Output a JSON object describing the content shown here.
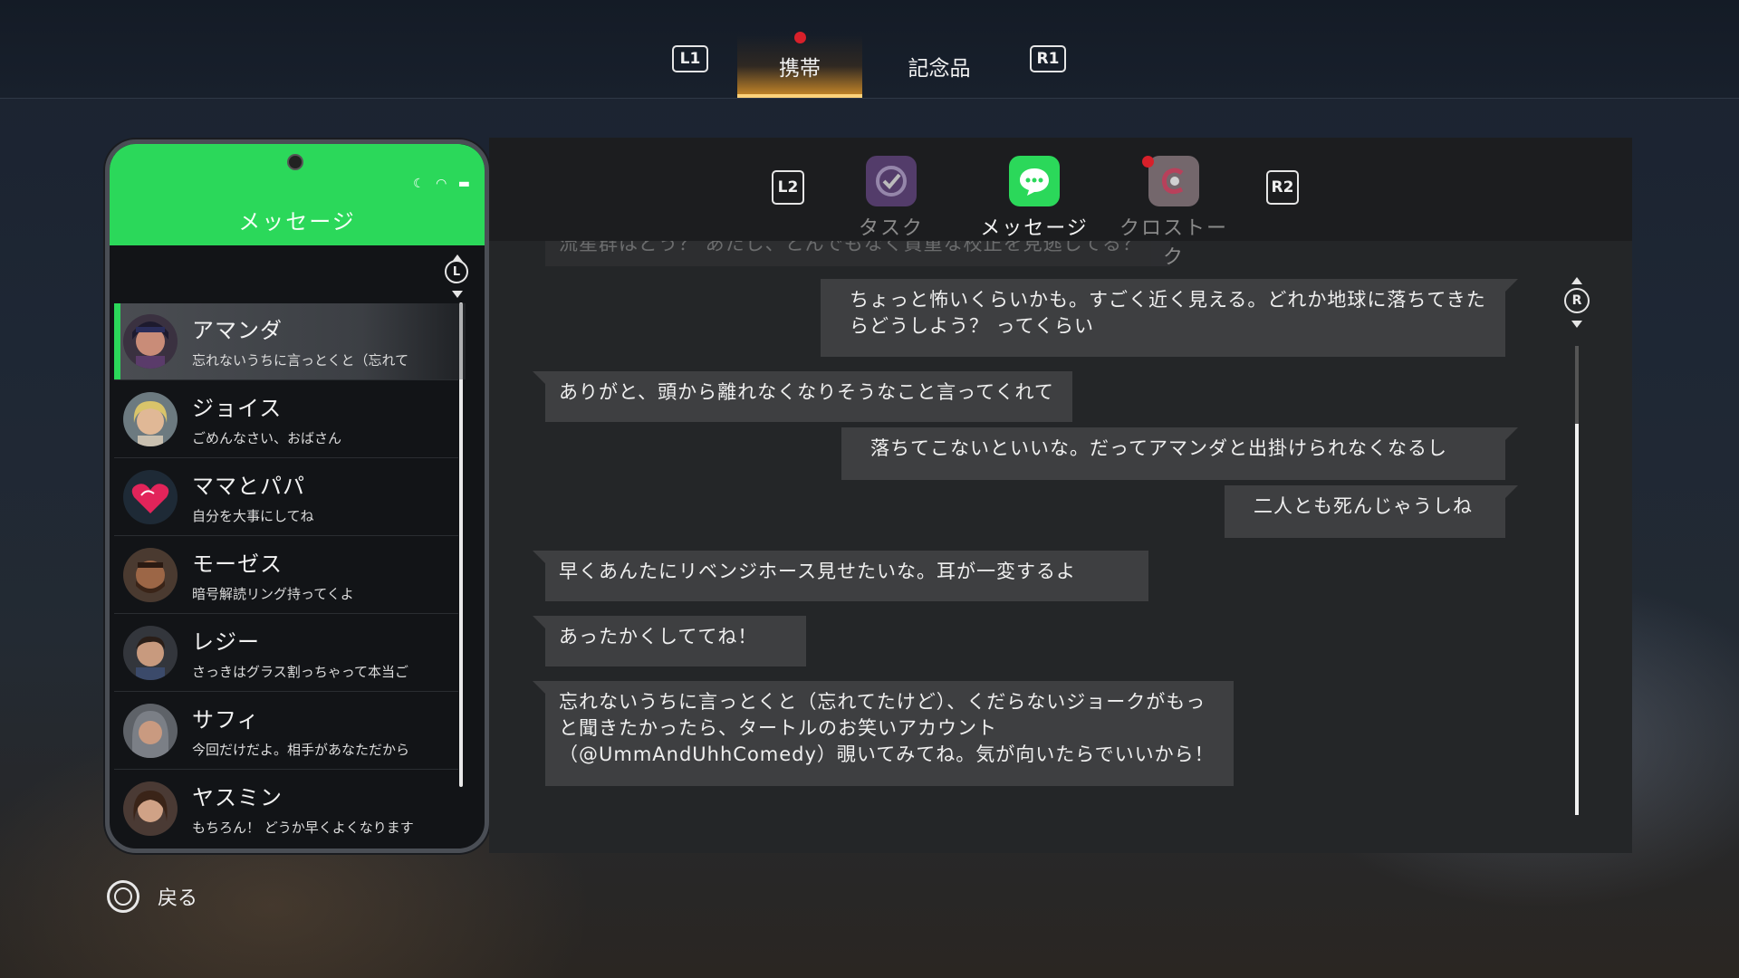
{
  "top_nav": {
    "left_button": "L1",
    "right_button": "R1",
    "tabs": [
      {
        "label": "携帯",
        "active": true,
        "notification": true
      },
      {
        "label": "記念品",
        "active": false,
        "notification": false
      }
    ]
  },
  "phone": {
    "title": "メッセージ",
    "scroll_button": "L",
    "contacts": [
      {
        "name": "アマンダ",
        "preview": "忘れないうちに言っとくと（忘れて",
        "selected": true
      },
      {
        "name": "ジョイス",
        "preview": "ごめんなさい、おばさん",
        "selected": false
      },
      {
        "name": "ママとパパ",
        "preview": "自分を大事にしてね",
        "selected": false
      },
      {
        "name": "モーゼス",
        "preview": "暗号解読リング持ってくよ",
        "selected": false
      },
      {
        "name": "レジー",
        "preview": "さっきはグラス割っちゃって本当ご",
        "selected": false
      },
      {
        "name": "サフィ",
        "preview": "今回だけだよ。相手があなただから",
        "selected": false
      },
      {
        "name": "ヤスミン",
        "preview": "もちろん！ どうか早くよくなります",
        "selected": false
      }
    ]
  },
  "apps": {
    "left_button": "L2",
    "right_button": "R2",
    "items": [
      {
        "label": "タスク",
        "icon": "task-check-icon",
        "active": false,
        "notification": false
      },
      {
        "label": "メッセージ",
        "icon": "chat-bubble-icon",
        "active": true,
        "notification": false
      },
      {
        "label": "クロストーク",
        "icon": "crosstalk-logo-icon",
        "active": false,
        "notification": true
      }
    ]
  },
  "chat": {
    "scroll_button": "R",
    "messages": [
      {
        "side": "left",
        "text": "流星群はどう？ あたし、とんでもなく貴重な校正を見逃してる？",
        "faded": true
      },
      {
        "side": "right",
        "text": "ちょっと怖いくらいかも。すごく近く見える。どれか地球に落ちてきたらどうしよう？ ってくらい"
      },
      {
        "side": "left",
        "text": "ありがと、頭から離れなくなりそうなこと言ってくれて"
      },
      {
        "side": "right",
        "text": "落ちてこないといいな。だってアマンダと出掛けられなくなるし"
      },
      {
        "side": "right",
        "text": "二人とも死んじゃうしね"
      },
      {
        "side": "left",
        "text": "早くあんたにリベンジホース見せたいな。耳が一変するよ"
      },
      {
        "side": "left",
        "text": "あったかくしててね！"
      },
      {
        "side": "left",
        "text": "忘れないうちに言っとくと（忘れてたけど）、くだらないジョークがもっと聞きたかったら、タートルのお笑いアカウント（@UmmAndUhhComedy）覗いてみてね。気が向いたらでいいから！"
      }
    ]
  },
  "footer": {
    "back_label": "戻る"
  },
  "colors": {
    "accent_green": "#2bd85a",
    "notification_red": "#d8202a",
    "tab_glow": "#f0a028"
  }
}
